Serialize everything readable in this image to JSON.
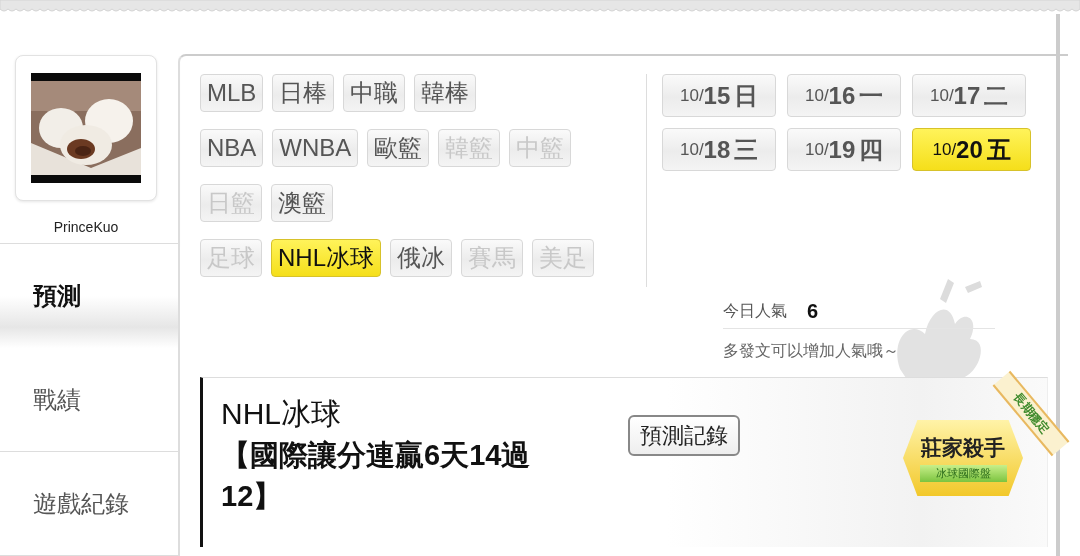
{
  "profile": {
    "name": "PrinceKuo"
  },
  "nav": [
    {
      "label": "預測",
      "selected": true
    },
    {
      "label": "戰績",
      "selected": false
    },
    {
      "label": "遊戲紀錄",
      "selected": false
    }
  ],
  "sport_rows": [
    {
      "items": [
        {
          "label": "MLB",
          "enabled": true,
          "selected": false
        },
        {
          "label": "日棒",
          "enabled": true,
          "selected": false
        },
        {
          "label": "中職",
          "enabled": true,
          "selected": false
        },
        {
          "label": "韓棒",
          "enabled": true,
          "selected": false
        }
      ]
    },
    {
      "items": [
        {
          "label": "NBA",
          "enabled": true,
          "selected": false
        },
        {
          "label": "WNBA",
          "enabled": true,
          "selected": false
        },
        {
          "label": "歐籃",
          "enabled": true,
          "selected": false
        },
        {
          "label": "韓籃",
          "enabled": false,
          "selected": false
        },
        {
          "label": "中籃",
          "enabled": false,
          "selected": false
        }
      ]
    },
    {
      "items": [
        {
          "label": "日籃",
          "enabled": false,
          "selected": false
        },
        {
          "label": "澳籃",
          "enabled": true,
          "selected": false
        }
      ]
    },
    {
      "items": [
        {
          "label": "足球",
          "enabled": false,
          "selected": false
        },
        {
          "label": "NHL冰球",
          "enabled": true,
          "selected": true
        },
        {
          "label": "俄冰",
          "enabled": true,
          "selected": false
        },
        {
          "label": "賽馬",
          "enabled": false,
          "selected": false
        },
        {
          "label": "美足",
          "enabled": false,
          "selected": false
        }
      ]
    }
  ],
  "dates": [
    {
      "month": "10/",
      "day": "15",
      "weekday": "日",
      "selected": false
    },
    {
      "month": "10/",
      "day": "16",
      "weekday": "一",
      "selected": false
    },
    {
      "month": "10/",
      "day": "17",
      "weekday": "二",
      "selected": false
    },
    {
      "month": "10/",
      "day": "18",
      "weekday": "三",
      "selected": false
    },
    {
      "month": "10/",
      "day": "19",
      "weekday": "四",
      "selected": false
    },
    {
      "month": "10/",
      "day": "20",
      "weekday": "五",
      "selected": true
    }
  ],
  "popularity": {
    "label": "今日人氣",
    "value": "6",
    "hint": "多發文可以增加人氣哦～"
  },
  "post": {
    "category": "NHL冰球",
    "title": "【國際讓分連贏6天14過12】",
    "button": "預測記錄",
    "badge": {
      "title": "莊家殺手",
      "subtitle": "冰球國際盤"
    },
    "ribbon": "長期穩定"
  }
}
